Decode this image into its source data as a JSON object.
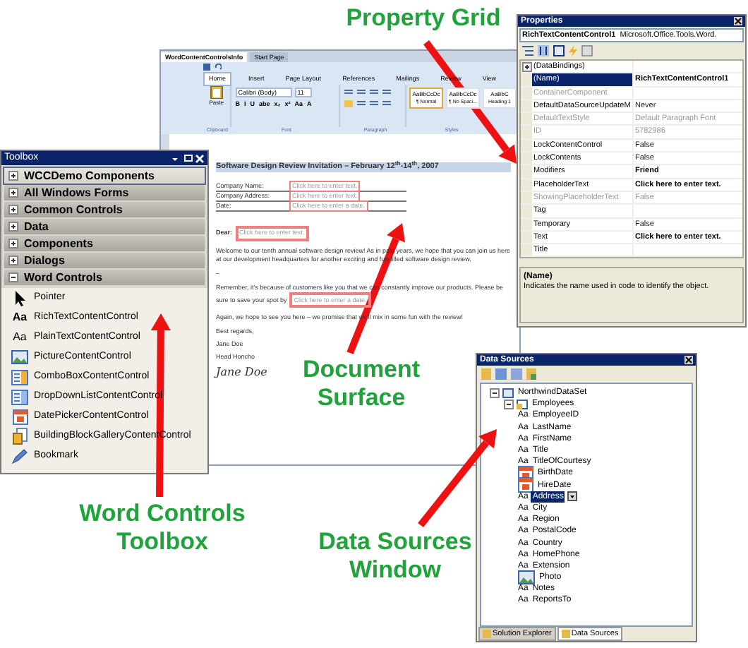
{
  "callouts": [
    {
      "text": "Property Grid"
    },
    {
      "text": "Document Surface"
    },
    {
      "text": "Word Controls Toolbox"
    },
    {
      "text": "Data Sources Window"
    }
  ],
  "document": {
    "tabs": [
      {
        "label": "WordContentControlsInfo",
        "selected": true
      },
      {
        "label": "Start Page",
        "selected": false
      }
    ],
    "ribbon_tabs": [
      {
        "label": "Home",
        "selected": true
      },
      {
        "label": "Insert",
        "selected": false
      },
      {
        "label": "Page Layout",
        "selected": false
      },
      {
        "label": "References",
        "selected": false
      },
      {
        "label": "Mailings",
        "selected": false
      },
      {
        "label": "Review",
        "selected": false
      },
      {
        "label": "View",
        "selected": false
      }
    ],
    "paste_label": "Paste",
    "font": "Calibri (Body)",
    "size": "11",
    "format_buttons": [
      "B",
      "I",
      "U",
      "abe",
      "x₂",
      "x²",
      "Aa",
      "A"
    ],
    "styles": [
      {
        "sample": "AaBbCcDc",
        "name": "¶ Normal",
        "selected": true
      },
      {
        "sample": "AaBbCcDc",
        "name": "¶ No Spaci...",
        "selected": false
      },
      {
        "sample": "AaBbC",
        "name": "Heading 1",
        "selected": false
      }
    ],
    "groups": [
      "Clipboard",
      "Font",
      "Paragraph",
      "Styles"
    ],
    "heading": "Software Design Review Invitation – February 12$^{th}$-14$^{th}$, 2007",
    "fields": [
      {
        "label": "Company Name:",
        "placeholder": "Click here to enter text."
      },
      {
        "label": "Company Address:",
        "placeholder": "Click here to enter text."
      },
      {
        "label": "Date:",
        "placeholder": "Click here to enter a date."
      }
    ],
    "greeting": "Dear:",
    "greeting_placeholder": "Click here to enter text.",
    "paragraph_1": "Welcome to our tenth annual software design review! As in past years, we hope that you can join us here at our development headquarters for another exciting and fun-filled software design review.",
    "dash": "–",
    "paragraph_2": "Remember, it's because of customers like you that we can constantly improve our products. Please be",
    "paragraph_2_end": "sure to save your spot by",
    "date_placeholder": "Click here to enter a date.",
    "paragraph_3": "Again, we hope to see you here – we promise that we'll mix in some fun with the review!",
    "closing": "Best regards,",
    "signer": "Jane Doe",
    "signer_title": "Head Honcho",
    "signature": "Jane Doe"
  },
  "toolbox": {
    "title": "Toolbox",
    "tabs": [
      {
        "label": "WCCDemo Components",
        "expanded": false,
        "selected": true
      },
      {
        "label": "All Windows Forms",
        "expanded": false,
        "selected": false
      },
      {
        "label": "Common Controls",
        "expanded": false,
        "selected": false
      },
      {
        "label": "Data",
        "expanded": false,
        "selected": false
      },
      {
        "label": "Components",
        "expanded": false,
        "selected": false
      },
      {
        "label": "Dialogs",
        "expanded": false,
        "selected": false
      },
      {
        "label": "Word Controls",
        "expanded": true,
        "selected": false
      }
    ],
    "items": [
      {
        "label": "Pointer",
        "kind": "pointer"
      },
      {
        "label": "RichTextContentControl",
        "kind": "richtext",
        "glyph": "Aa"
      },
      {
        "label": "PlainTextContentControl",
        "kind": "plaintext",
        "glyph": "Aa"
      },
      {
        "label": "PictureContentControl",
        "kind": "picture"
      },
      {
        "label": "ComboBoxContentControl",
        "kind": "combo"
      },
      {
        "label": "DropDownListContentControl",
        "kind": "list"
      },
      {
        "label": "DatePickerContentControl",
        "kind": "date"
      },
      {
        "label": "BuildingBlockGalleryContentControl",
        "kind": "gallery"
      },
      {
        "label": "Bookmark",
        "kind": "bookmark"
      }
    ]
  },
  "properties": {
    "title": "Properties",
    "object": "RichTextContentControl1",
    "object_type": "Microsoft.Office.Tools.Word.",
    "rows": [
      {
        "name": "(DataBindings)",
        "kind": "category",
        "expanded": false
      },
      {
        "name": "(Name)",
        "value": "RichTextContentControl1",
        "selected": true,
        "disabled": false,
        "modified": true
      },
      {
        "name": "ContainerComponent",
        "selected": false,
        "disabled": true
      },
      {
        "name": "DefaultDataSourceUpdateM",
        "value": "Never",
        "selected": false,
        "disabled": false,
        "modified": false
      },
      {
        "name": "DefaultTextStyle",
        "value": "Default Paragraph Font",
        "selected": false,
        "disabled": true,
        "modified": false
      },
      {
        "name": "ID",
        "value": "5782986",
        "selected": false,
        "disabled": true,
        "modified": false
      },
      {
        "name": "LockContentControl",
        "value": "False",
        "selected": false,
        "disabled": false,
        "modified": false
      },
      {
        "name": "LockContents",
        "value": "False",
        "selected": false,
        "disabled": false,
        "modified": false
      },
      {
        "name": "Modifiers",
        "value": "Friend",
        "selected": false,
        "disabled": false,
        "modified": true
      },
      {
        "name": "PlaceholderText",
        "value": "Click here to enter text.",
        "selected": false,
        "disabled": false,
        "modified": true
      },
      {
        "name": "ShowingPlaceholderText",
        "value": "False",
        "selected": false,
        "disabled": true,
        "modified": false
      },
      {
        "name": "Tag",
        "selected": false,
        "disabled": false
      },
      {
        "name": "Temporary",
        "value": "False",
        "selected": false,
        "disabled": false,
        "modified": false
      },
      {
        "name": "Text",
        "value": "Click here to enter text.",
        "selected": false,
        "disabled": false,
        "modified": true
      },
      {
        "name": "Title",
        "selected": false,
        "disabled": false
      }
    ],
    "description_title": "(Name)",
    "description": "Indicates the name used in code to identify the object."
  },
  "data_sources": {
    "title": "Data Sources",
    "tree": [
      {
        "label": "NorthwindDataSet",
        "kind": "dataset",
        "expanded": true,
        "children": [
          {
            "label": "Employees",
            "kind": "table",
            "expanded": true,
            "children": [
              {
                "label": "EmployeeID",
                "kind": "text",
                "glyph": "Aa",
                "selected": false
              },
              {
                "label": "LastName",
                "kind": "text",
                "glyph": "Aa",
                "selected": false
              },
              {
                "label": "FirstName",
                "kind": "text",
                "glyph": "Aa",
                "selected": false
              },
              {
                "label": "Title",
                "kind": "text",
                "glyph": "Aa",
                "selected": false
              },
              {
                "label": "TitleOfCourtesy",
                "kind": "text",
                "glyph": "Aa",
                "selected": false
              },
              {
                "label": "BirthDate",
                "kind": "date",
                "selected": false
              },
              {
                "label": "HireDate",
                "kind": "date",
                "selected": false
              },
              {
                "label": "Address",
                "kind": "text",
                "glyph": "Aa",
                "selected": true
              },
              {
                "label": "City",
                "kind": "text",
                "glyph": "Aa",
                "selected": false
              },
              {
                "label": "Region",
                "kind": "text",
                "glyph": "Aa",
                "selected": false
              },
              {
                "label": "PostalCode",
                "kind": "text",
                "glyph": "Aa",
                "selected": false
              },
              {
                "label": "Country",
                "kind": "text",
                "glyph": "Aa",
                "selected": false
              },
              {
                "label": "HomePhone",
                "kind": "text",
                "glyph": "Aa",
                "selected": false
              },
              {
                "label": "Extension",
                "kind": "text",
                "glyph": "Aa",
                "selected": false
              },
              {
                "label": "Photo",
                "kind": "image",
                "selected": false
              },
              {
                "label": "Notes",
                "kind": "text",
                "glyph": "Aa",
                "selected": false
              },
              {
                "label": "ReportsTo",
                "kind": "text",
                "glyph": "Aa",
                "selected": false
              }
            ]
          }
        ]
      }
    ],
    "tabs": [
      {
        "label": "Solution Explorer",
        "selected": false
      },
      {
        "label": "Data Sources",
        "selected": true
      }
    ]
  }
}
